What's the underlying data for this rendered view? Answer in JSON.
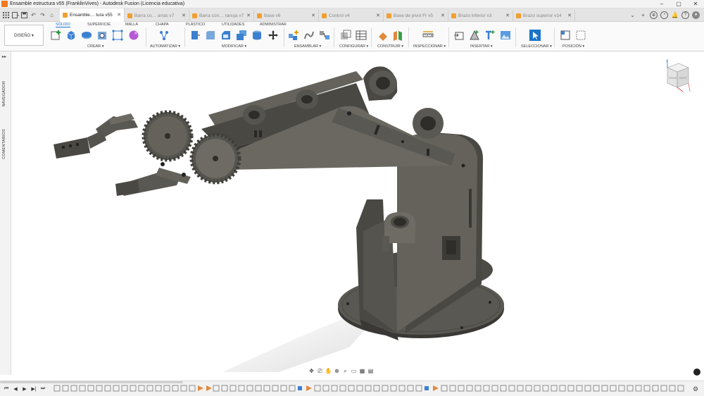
{
  "window": {
    "title": "Ensamble estructura v55 (FranklinVives) - Autodesk Fusion (Licencia educativa)",
    "controls": [
      "–",
      "▢",
      "✕"
    ]
  },
  "tabs": [
    {
      "label": "Ensamble… tura v55",
      "active": true
    },
    {
      "label": "Barra co… arras v7",
      "active": false
    },
    {
      "label": "Barra con… ranuja v7",
      "active": false
    },
    {
      "label": "Base v6",
      "active": false
    },
    {
      "label": "Control v4",
      "active": false
    },
    {
      "label": "Base de pivot Fr v5",
      "active": false
    },
    {
      "label": "Brazo inferior v3",
      "active": false
    },
    {
      "label": "Brazo superior v14",
      "active": false
    }
  ],
  "ribbon": {
    "design_button": "DISEÑO ▾",
    "tabs": [
      "SÓLIDO",
      "SUPERFICIE",
      "MALLA",
      "CHAPA",
      "PLÁSTICO",
      "UTILIDADES",
      "ADMINISTRAR"
    ],
    "groups": [
      "CREAR ▾",
      "AUTOMATIZAR ▾",
      "MODIFICAR ▾",
      "ENSAMBLAR ▾",
      "CONFIGURAR ▾",
      "CONSTRUIR ▾",
      "INSPECCIONAR ▾",
      "INSERTAR ▾",
      "SELECCIONAR ▾",
      "POSICIÓN ▾"
    ]
  },
  "left_panel": {
    "navigator": "NAVEGADOR",
    "comments": "COMENTARIOS"
  },
  "viewcube": {
    "faces": [
      "FRONT",
      "RIGHT"
    ],
    "axis": "Z"
  },
  "colors": {
    "accent": "#1a73c9",
    "model": "#5a5852",
    "model_dark": "#3f3d38",
    "model_light": "#75736c"
  }
}
